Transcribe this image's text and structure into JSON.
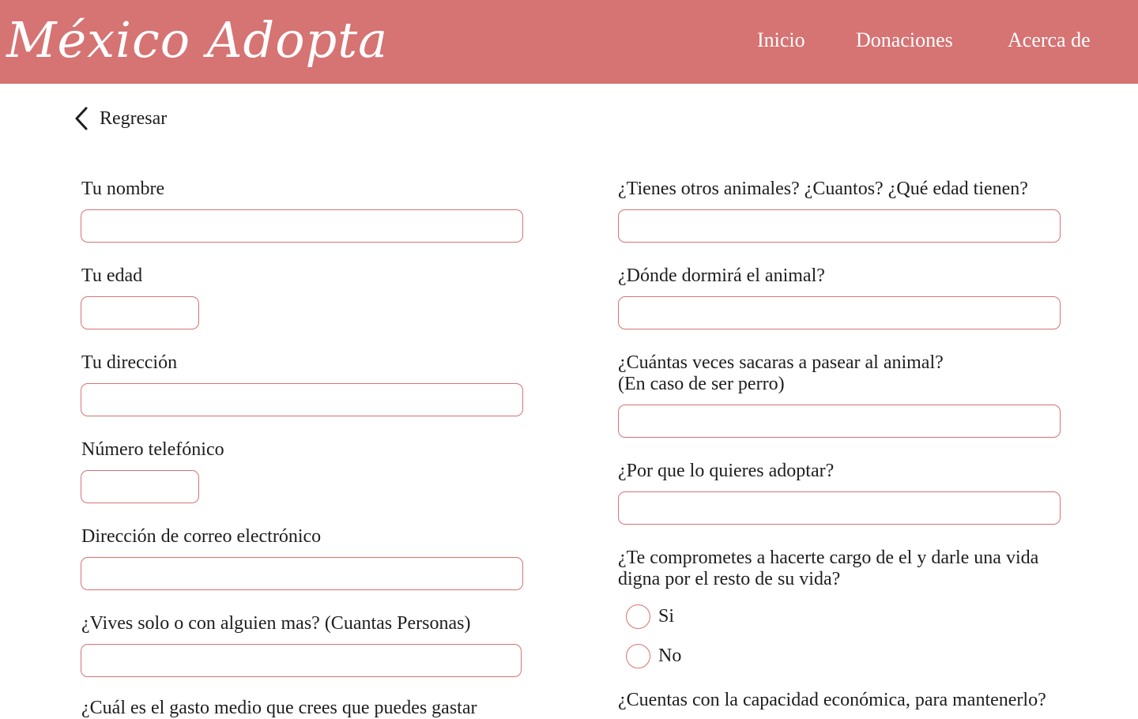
{
  "header": {
    "logo": "México Adopta",
    "nav": [
      "Inicio",
      "Donaciones",
      "Acerca de"
    ],
    "background_color": "#d67373"
  },
  "back": {
    "icon": "chevron-left-icon",
    "label": "Regresar"
  },
  "form": {
    "left": [
      {
        "label": "Tu nombre",
        "value": ""
      },
      {
        "label": "Tu edad",
        "value": ""
      },
      {
        "label": "Tu dirección",
        "value": ""
      },
      {
        "label": "Número telefónico",
        "value": ""
      },
      {
        "label": "Dirección de correo electrónico",
        "value": ""
      },
      {
        "label": "¿Vives solo o con alguien mas? (Cuantas Personas)",
        "value": ""
      },
      {
        "label": "¿Cuál es el gasto medio que crees que puedes gastar"
      }
    ],
    "right": [
      {
        "label": "¿Tienes otros animales? ¿Cuantos? ¿Qué edad tienen?",
        "value": ""
      },
      {
        "label": "¿Dónde dormirá el animal?",
        "value": ""
      },
      {
        "label_line1": "¿Cuántas veces sacaras a pasear al animal?",
        "label_line2": "(En caso de ser perro)",
        "value": ""
      },
      {
        "label": "¿Por que lo quieres adoptar?",
        "value": ""
      },
      {
        "label_line1": "¿Te comprometes a hacerte cargo de el y darle una vida",
        "label_line2": "digna por el resto de su vida?"
      },
      {
        "label": "¿Cuentas con  la capacidad económica, para mantenerlo?"
      }
    ],
    "commitment_options": [
      "Si",
      "No"
    ],
    "field_border_color": "#d67373"
  }
}
